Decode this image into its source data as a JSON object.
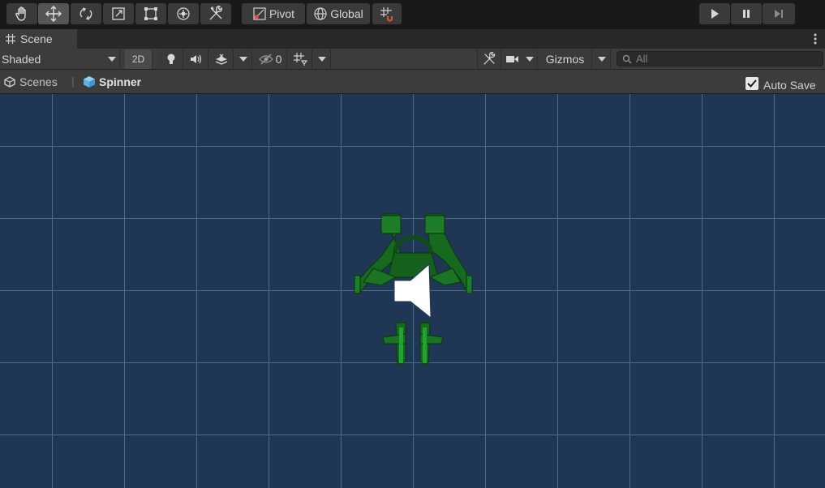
{
  "toolbar": {
    "tools": [
      {
        "name": "hand-tool",
        "icon": "hand-icon"
      },
      {
        "name": "move-tool",
        "icon": "move-icon",
        "active": true
      },
      {
        "name": "rotate-tool",
        "icon": "rotate-icon"
      },
      {
        "name": "scale-tool",
        "icon": "scale-icon"
      },
      {
        "name": "rect-tool",
        "icon": "rect-icon"
      },
      {
        "name": "transform-tool",
        "icon": "transform-icon"
      },
      {
        "name": "custom-tool",
        "icon": "tools-icon"
      }
    ],
    "pivot_label": "Pivot",
    "global_label": "Global",
    "play_icon": "play-icon",
    "pause_icon": "pause-icon",
    "step_icon": "step-icon"
  },
  "tab": {
    "title": "Scene",
    "more_icon": "kebab-menu-icon"
  },
  "scene_toolbar": {
    "draw_mode": "Shaded",
    "mode_2d": "2D",
    "hidden_count": "0",
    "gizmos_label": "Gizmos",
    "search_placeholder": "All"
  },
  "breadcrumb": {
    "root": "Scenes",
    "current": "Spinner",
    "auto_save_label": "Auto Save",
    "auto_save_checked": true
  },
  "viewport": {
    "background": "#1f3654",
    "grid_color": "#4d6b8c",
    "model_color": "#1f7a2a",
    "audio_icon": "speaker-icon"
  }
}
